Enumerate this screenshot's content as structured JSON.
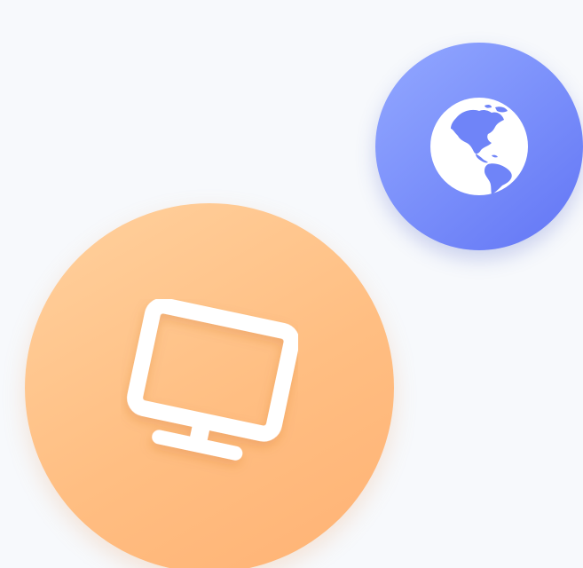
{
  "icons": [
    {
      "name": "globe-icon",
      "background": "#7d92fb",
      "foreground": "#ffffff"
    },
    {
      "name": "monitor-icon",
      "background": "#ffbe82",
      "foreground": "#ffffff"
    }
  ]
}
